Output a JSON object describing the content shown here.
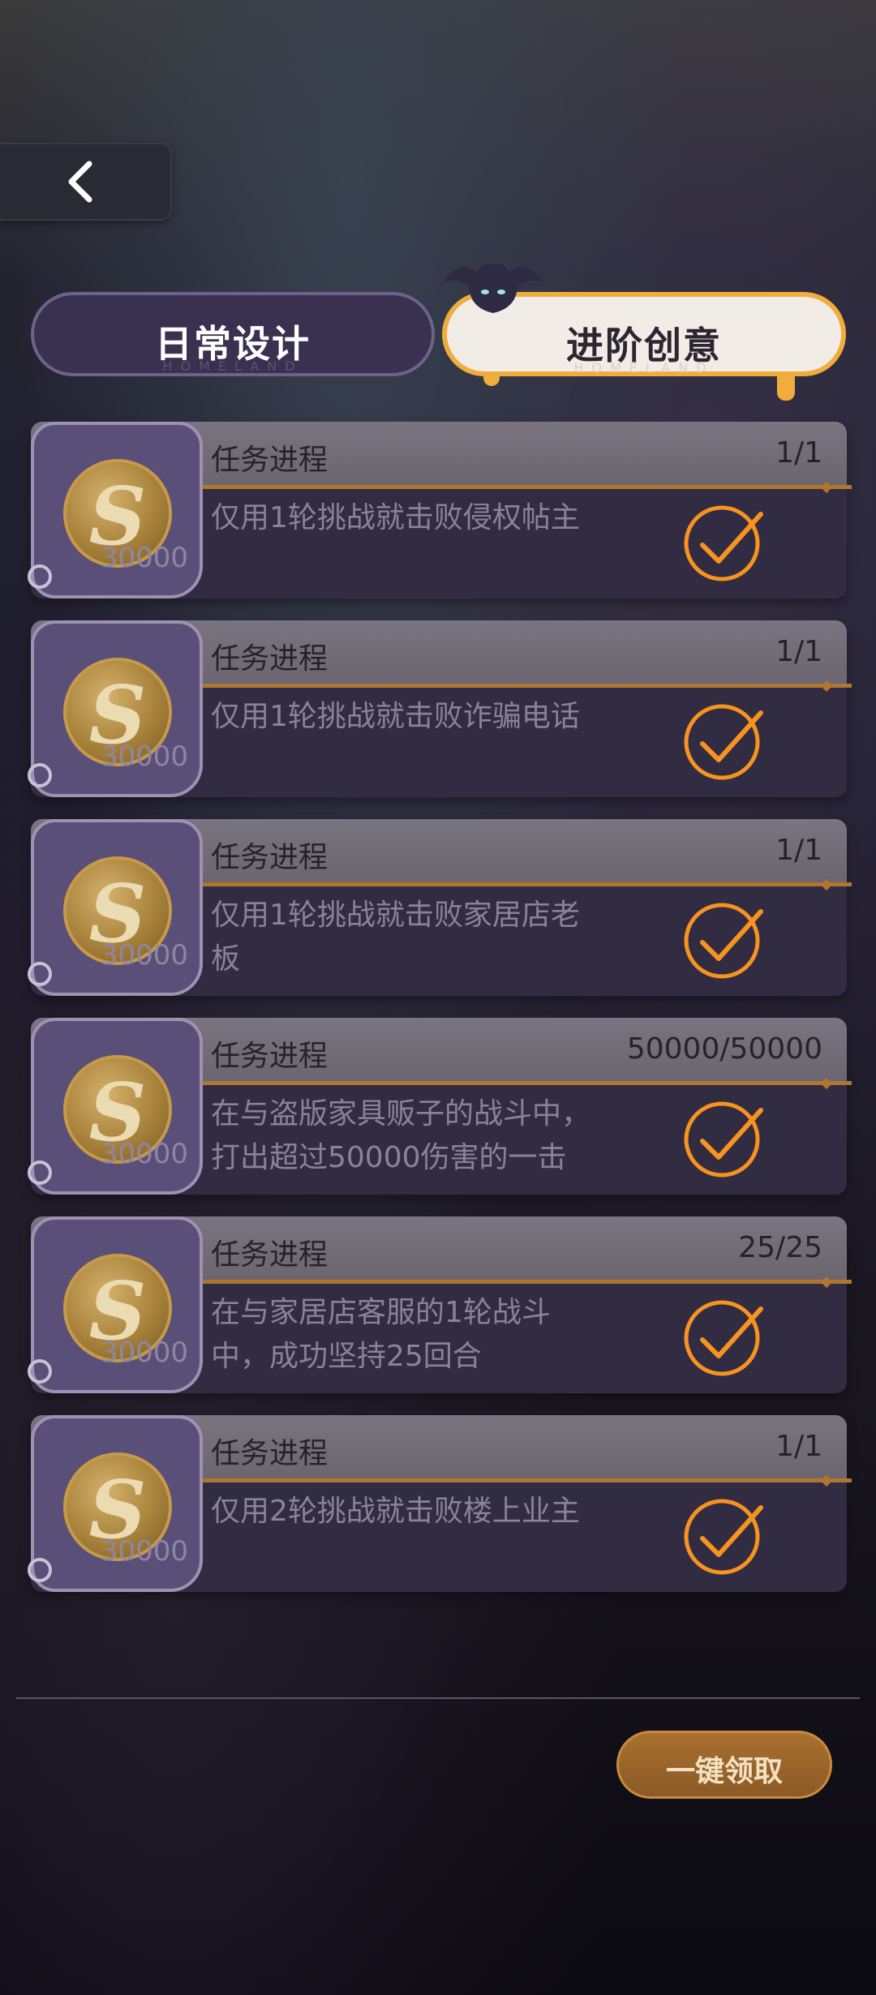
{
  "header": {
    "back_icon": "chevron-left-icon"
  },
  "tabs": [
    {
      "label": "日常设计",
      "sublabel": "HOMELAND",
      "active": false
    },
    {
      "label": "进阶创意",
      "sublabel": "HOMELAND",
      "active": true
    }
  ],
  "tasks": [
    {
      "title": "任务进程",
      "progress": "1/1",
      "description": "仅用1轮挑战就击败侵权帖主",
      "reward": "30000",
      "completed": true
    },
    {
      "title": "任务进程",
      "progress": "1/1",
      "description": "仅用1轮挑战就击败诈骗电话",
      "reward": "30000",
      "completed": true
    },
    {
      "title": "任务进程",
      "progress": "1/1",
      "description": "仅用1轮挑战就击败家居店老板",
      "reward": "30000",
      "completed": true
    },
    {
      "title": "任务进程",
      "progress": "50000/50000",
      "description": "在与盗版家具贩子的战斗中，打出超过50000伤害的一击",
      "reward": "30000",
      "completed": true
    },
    {
      "title": "任务进程",
      "progress": "25/25",
      "description": "在与家居店客服的1轮战斗中，成功坚持25回合",
      "reward": "30000",
      "completed": true
    },
    {
      "title": "任务进程",
      "progress": "1/1",
      "description": "仅用2轮挑战就击败楼上业主",
      "reward": "30000",
      "completed": true
    }
  ],
  "footer": {
    "claim_all_label": "一键领取"
  },
  "colors": {
    "accent_orange": "#f0ad3c",
    "check_orange": "#f7931e",
    "tab_inactive": "#3a3150",
    "tab_active": "#f1ece6"
  }
}
